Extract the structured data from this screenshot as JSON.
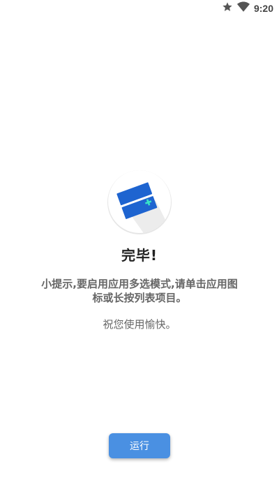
{
  "status_bar": {
    "time": "9:20",
    "icons": [
      "star-icon",
      "wifi-icon"
    ]
  },
  "main": {
    "title": "完毕!",
    "tip": "小提示,要启用应用多选模式,请单击应用图标或长按列表项目。",
    "wish": "祝您使用愉快。"
  },
  "actions": {
    "run_label": "运行"
  },
  "colors": {
    "accent": "#4A90E2",
    "logo_blue": "#1E64D0",
    "logo_plus": "#39E6C6",
    "text_primary": "#222222",
    "text_secondary": "#666666"
  }
}
